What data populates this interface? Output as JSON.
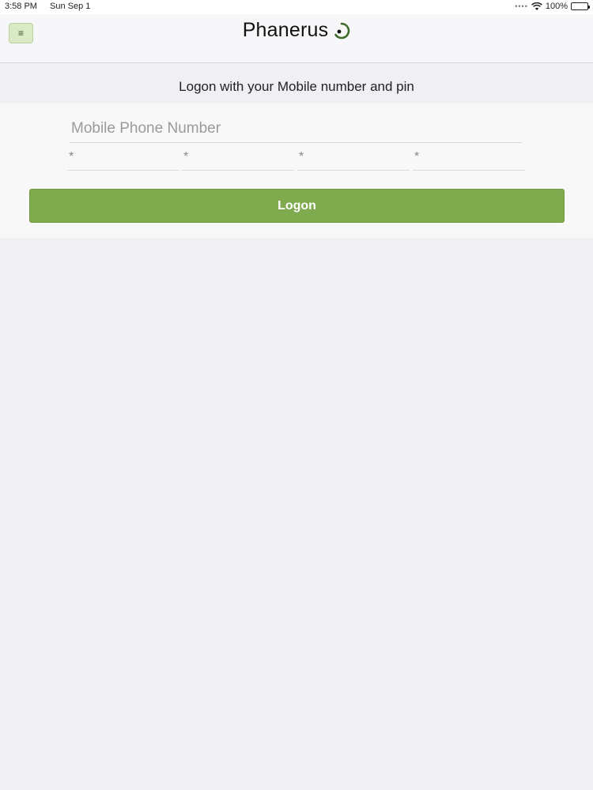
{
  "status_bar": {
    "time": "3:58 PM",
    "date": "Sun Sep 1",
    "battery": "100%"
  },
  "header": {
    "brand": "Phanerus",
    "menu_icon": "hamburger-menu-icon"
  },
  "login": {
    "subtitle": "Logon with your Mobile number and pin",
    "phone_placeholder": "Mobile Phone Number",
    "pin_placeholder": "*",
    "logon_label": "Logon"
  },
  "colors": {
    "accent": "#7faa4e",
    "menu_button_bg": "#d9eac4",
    "page_bg": "#efeff4"
  }
}
